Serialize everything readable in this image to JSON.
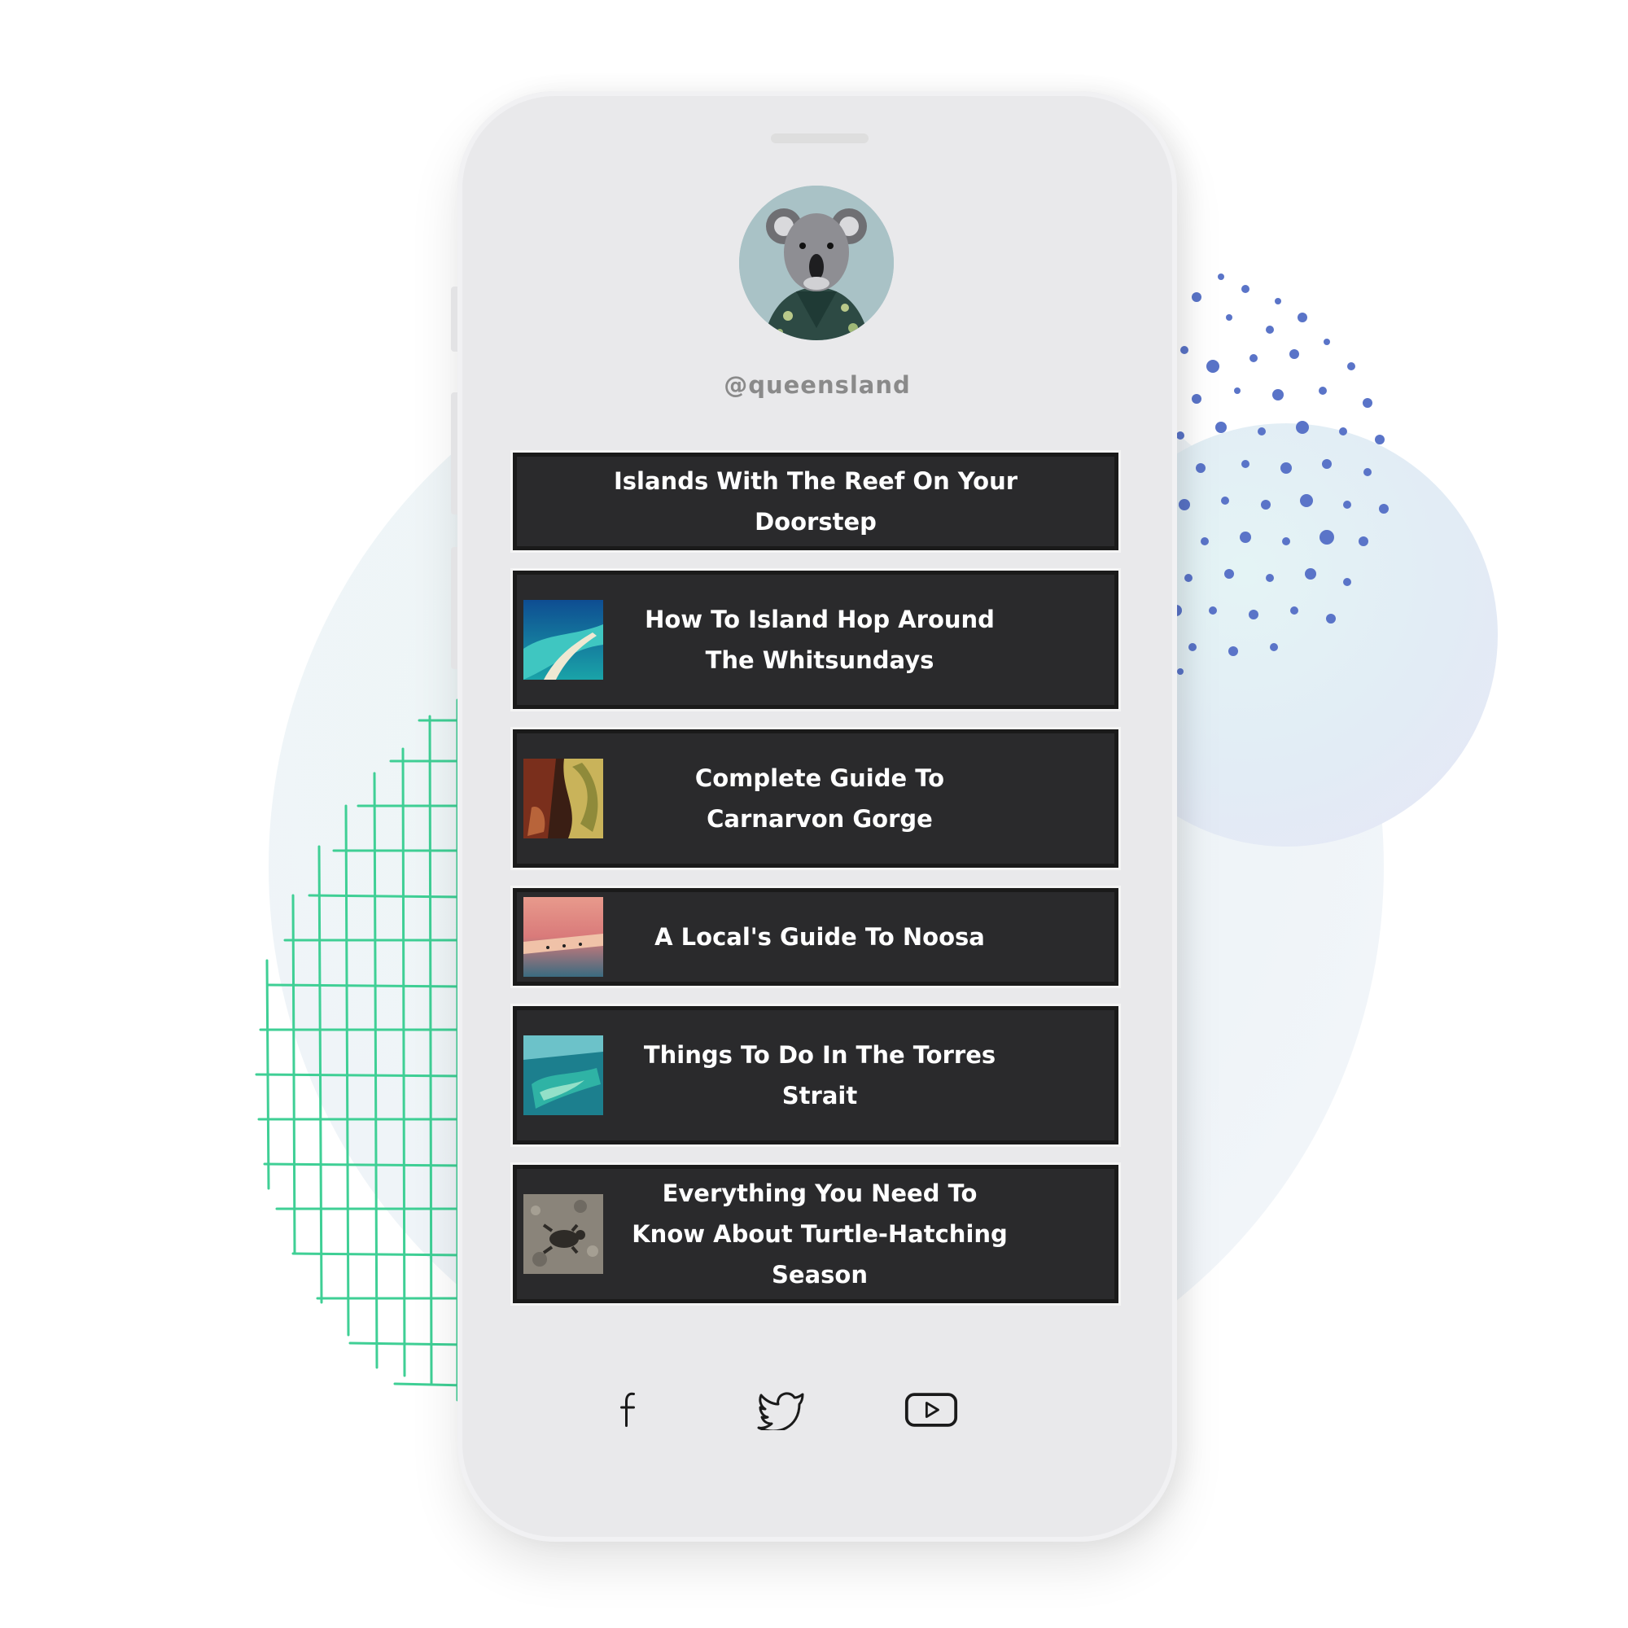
{
  "profile": {
    "handle": "@queensland"
  },
  "links": [
    {
      "label": "Islands With The Reef On Your Doorstep",
      "thumbnail": "none"
    },
    {
      "label": "How To Island Hop Around The Whitsundays",
      "thumbnail": "sandbar-aerial-photo"
    },
    {
      "label": "Complete Guide To Carnarvon Gorge",
      "thumbnail": "gorge-rock-photo"
    },
    {
      "label": "A Local's Guide To Noosa",
      "thumbnail": "sunset-beach-photo"
    },
    {
      "label": "Things To Do In The Torres Strait",
      "thumbnail": "reef-island-aerial-photo"
    },
    {
      "label": "Everything You Need To Know About Turtle-Hatching Season",
      "thumbnail": "turtle-sand-photo"
    }
  ],
  "social": [
    "facebook-icon",
    "twitter-icon",
    "youtube-icon"
  ],
  "colors": {
    "phone_body": "#e9e9eb",
    "link_background": "#2a2a2c",
    "link_text": "#ffffff",
    "handle_text": "#8a8a8a",
    "grid_accent": "#3fcf95",
    "dots_accent": "#5a74c8"
  }
}
